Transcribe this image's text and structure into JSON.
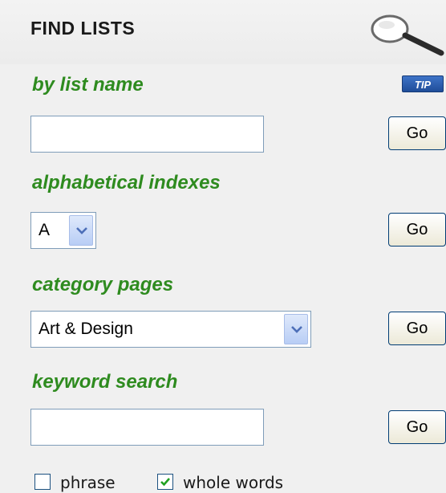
{
  "panel": {
    "title": "FIND LISTS",
    "tip_label": "TIP"
  },
  "sections": {
    "list_name": {
      "heading": "by list name",
      "input_value": "",
      "go_label": "Go"
    },
    "alphabetical": {
      "heading": "alphabetical indexes",
      "selected": "A",
      "go_label": "Go"
    },
    "category": {
      "heading": "category pages",
      "selected": "Art & Design",
      "go_label": "Go"
    },
    "keyword": {
      "heading": "keyword search",
      "input_value": "",
      "go_label": "Go"
    }
  },
  "options": {
    "phrase": {
      "label": "phrase",
      "checked": false
    },
    "whole_words": {
      "label": "whole words",
      "checked": true
    }
  },
  "icons": {
    "search": "magnifier-icon",
    "dropdown": "chevron-down-icon",
    "check": "check-icon"
  },
  "colors": {
    "heading": "#2e8b1f",
    "panel_bg": "#f0f0f0",
    "tip_bg": "#1f4d99"
  }
}
